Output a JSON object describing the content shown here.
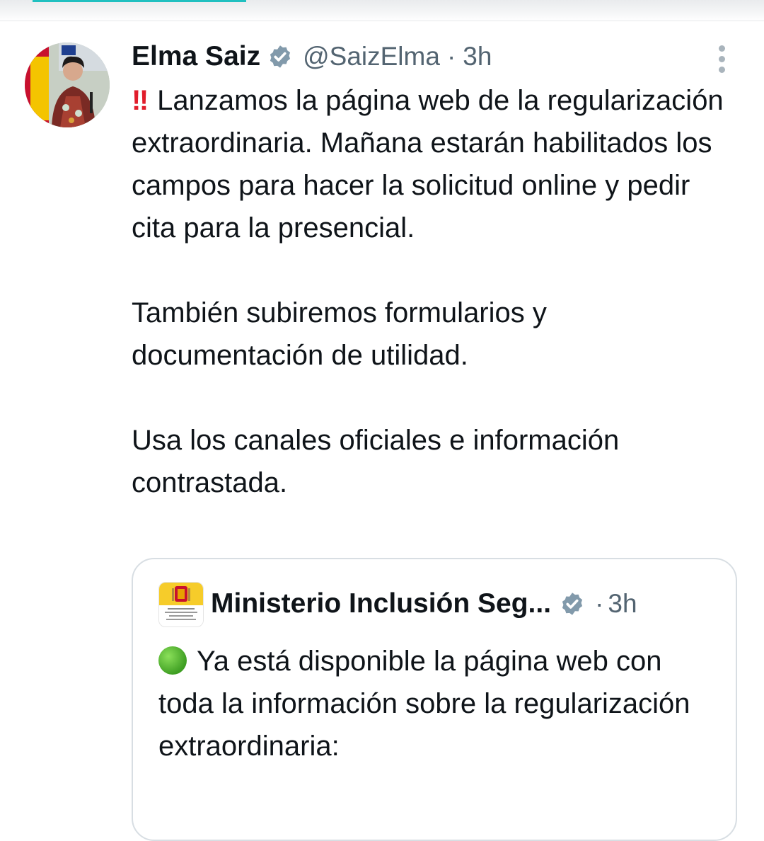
{
  "colors": {
    "text_primary": "#0f1419",
    "text_secondary": "#536471",
    "verified_badge": "#829aab",
    "alert_red": "#e11d2b",
    "status_green": "#4caf2a",
    "border": "#d8dee3"
  },
  "tweet": {
    "author_name": "Elma Saiz",
    "handle": "@SaizElma",
    "separator": "·",
    "time": "3h",
    "avatar_icon": "user-avatar-photo",
    "more_icon": "more-vertical-icon",
    "alert_emoji": "‼",
    "text_first": "Lanzamos la página web de la regularización extraordinaria. Mañana estarán habilitados los campos para hacer la solicitud online y pedir cita para la presencial.",
    "text_second": "También subiremos formularios y documentación de utilidad.",
    "text_third": "Usa los canales oficiales e información contrastada."
  },
  "quoted_tweet": {
    "author_name": "Ministerio Inclusión Seg...",
    "separator": "·",
    "time": "3h",
    "logo_icon": "government-coat-of-arms-logo",
    "status_emoji": "green-circle",
    "text": "Ya está disponible la página web con toda la información sobre la regularización extraordinaria:"
  }
}
